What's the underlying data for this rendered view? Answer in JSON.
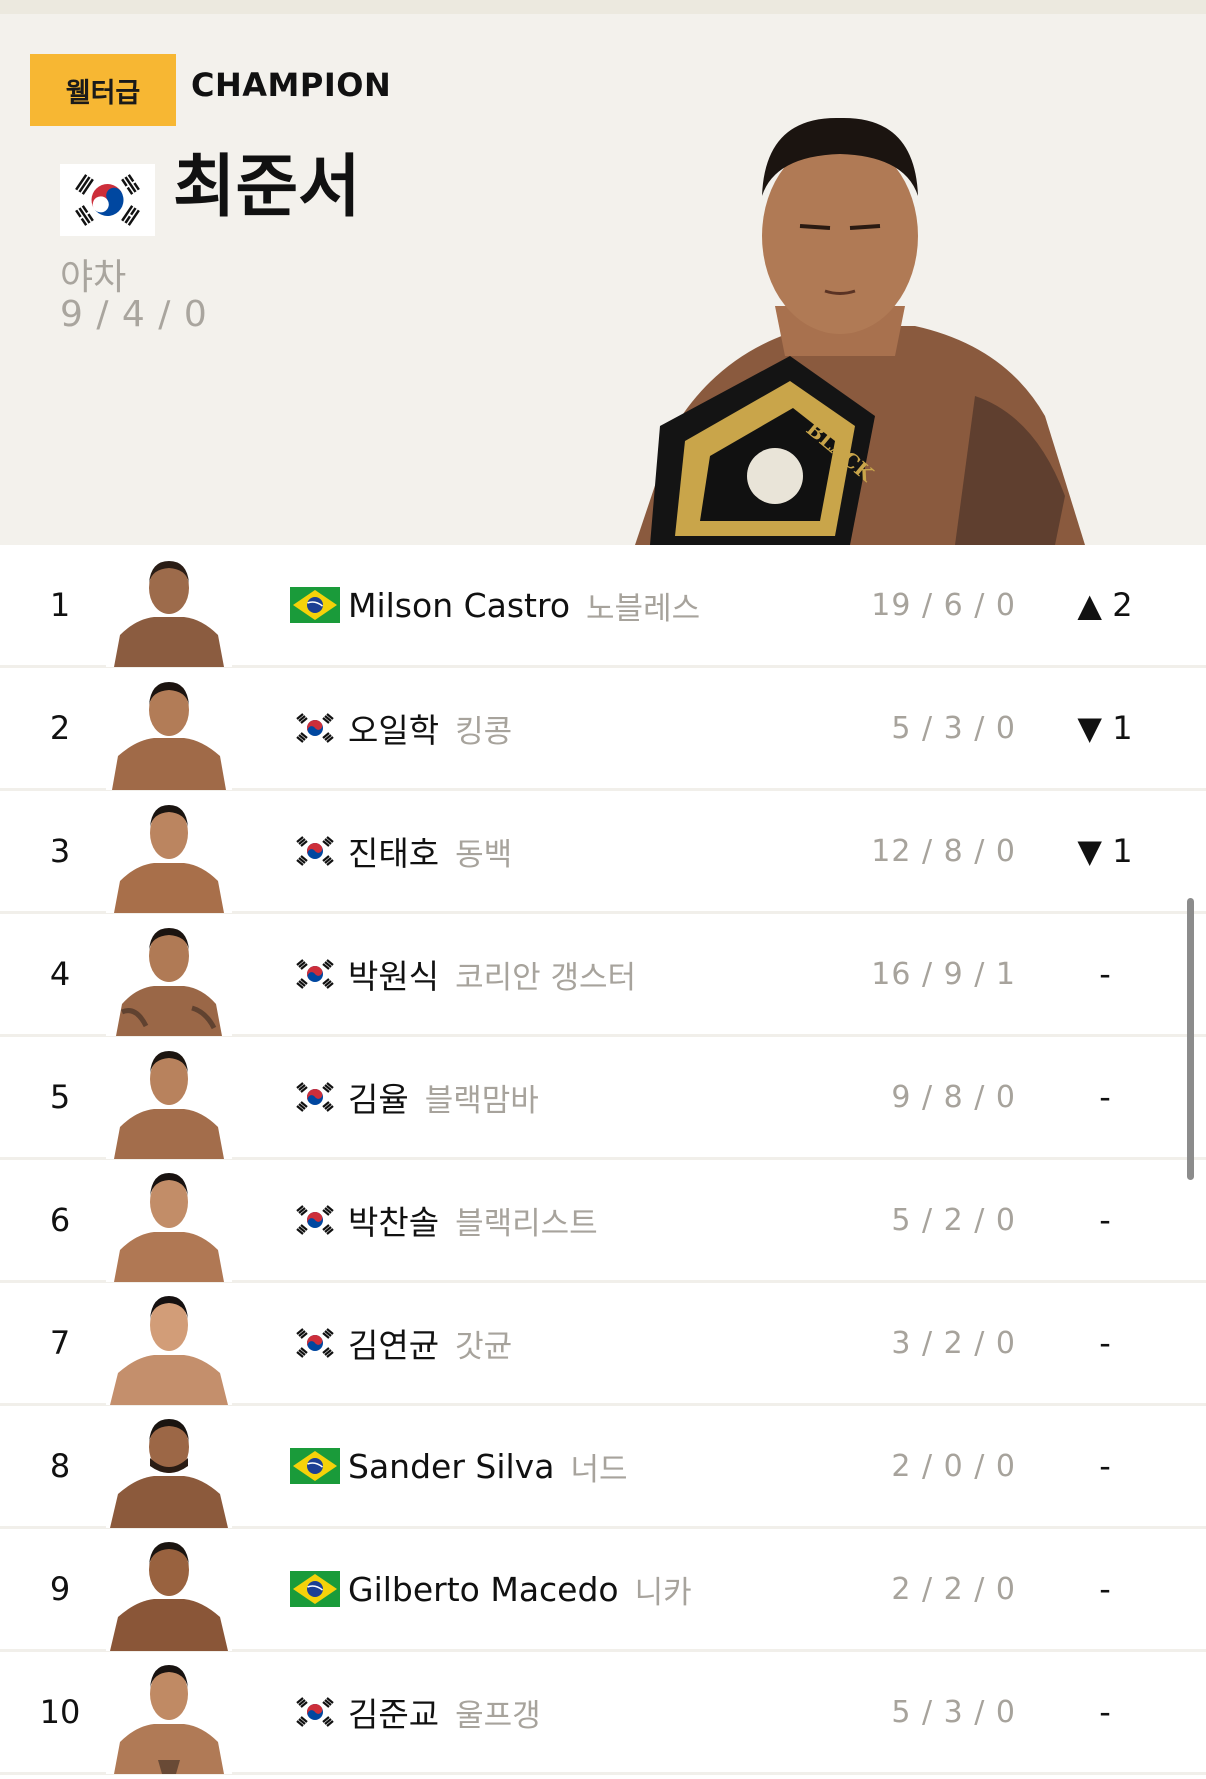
{
  "champion": {
    "division": "웰터급",
    "title_label": "CHAMPION",
    "name": "최준서",
    "nickname": "야차",
    "record": "9 / 4 / 0",
    "flag": "korea-flag",
    "photo_belt_text": "BLACK COMBAT"
  },
  "rankings": [
    {
      "rank": "1",
      "name": "Milson Castro",
      "nickname": "노블레스",
      "record": "19 / 6 / 0",
      "movement": "▲ 2",
      "flag": "brazil"
    },
    {
      "rank": "2",
      "name": "오일학",
      "nickname": "킹콩",
      "record": "5 / 3 / 0",
      "movement": "▼ 1",
      "flag": "korea"
    },
    {
      "rank": "3",
      "name": "진태호",
      "nickname": "동백",
      "record": "12 / 8 / 0",
      "movement": "▼ 1",
      "flag": "korea"
    },
    {
      "rank": "4",
      "name": "박원식",
      "nickname": "코리안 갱스터",
      "record": "16 / 9 / 1",
      "movement": "-",
      "flag": "korea"
    },
    {
      "rank": "5",
      "name": "김율",
      "nickname": "블랙맘바",
      "record": "9 / 8 / 0",
      "movement": "-",
      "flag": "korea"
    },
    {
      "rank": "6",
      "name": "박찬솔",
      "nickname": "블랙리스트",
      "record": "5 / 2 / 0",
      "movement": "-",
      "flag": "korea"
    },
    {
      "rank": "7",
      "name": "김연균",
      "nickname": "갓균",
      "record": "3 / 2 / 0",
      "movement": "-",
      "flag": "korea"
    },
    {
      "rank": "8",
      "name": "Sander Silva",
      "nickname": "너드",
      "record": "2 / 0 / 0",
      "movement": "-",
      "flag": "brazil"
    },
    {
      "rank": "9",
      "name": "Gilberto Macedo",
      "nickname": "니카",
      "record": "2 / 2 / 0",
      "movement": "-",
      "flag": "brazil"
    },
    {
      "rank": "10",
      "name": "김준교",
      "nickname": "울프갱",
      "record": "5 / 3 / 0",
      "movement": "-",
      "flag": "korea"
    }
  ],
  "colors": {
    "accent": "#f7b733",
    "hero_bg": "#f3f1ec",
    "muted_text": "#a7a39c",
    "brazil_green": "#1a9b3a",
    "brazil_yellow": "#f5d20a",
    "brazil_blue": "#1c3f94",
    "korea_red": "#cd2e3a",
    "korea_blue": "#0047a0"
  }
}
